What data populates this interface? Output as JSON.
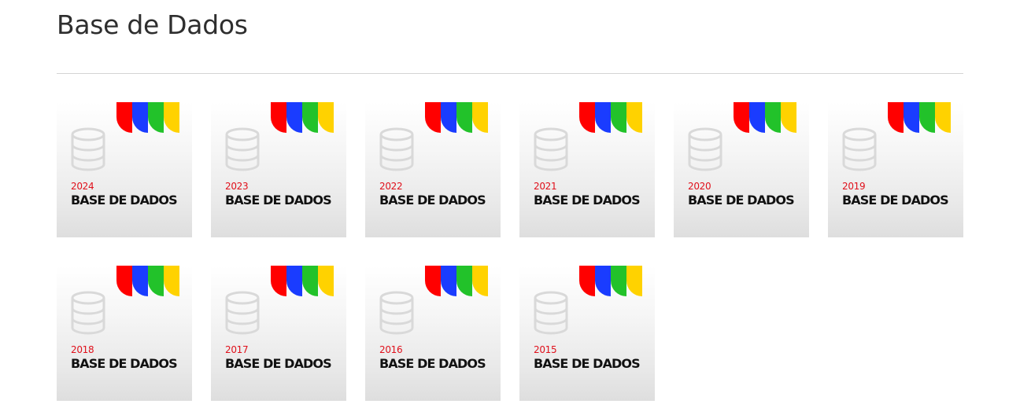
{
  "page": {
    "title": "Base de Dados"
  },
  "theme": {
    "stripe_colors": [
      "#ff0000",
      "#1a3cff",
      "#22c22a",
      "#ffd200"
    ],
    "year_color": "#e0101b",
    "icon": "database-icon"
  },
  "cards": [
    {
      "year": "2024",
      "label": "BASE DE DADOS"
    },
    {
      "year": "2023",
      "label": "BASE DE DADOS"
    },
    {
      "year": "2022",
      "label": "BASE DE DADOS"
    },
    {
      "year": "2021",
      "label": "BASE DE DADOS"
    },
    {
      "year": "2020",
      "label": "BASE DE DADOS"
    },
    {
      "year": "2019",
      "label": "BASE DE DADOS"
    },
    {
      "year": "2018",
      "label": "BASE DE DADOS"
    },
    {
      "year": "2017",
      "label": "BASE DE DADOS"
    },
    {
      "year": "2016",
      "label": "BASE DE DADOS"
    },
    {
      "year": "2015",
      "label": "BASE DE DADOS"
    }
  ]
}
